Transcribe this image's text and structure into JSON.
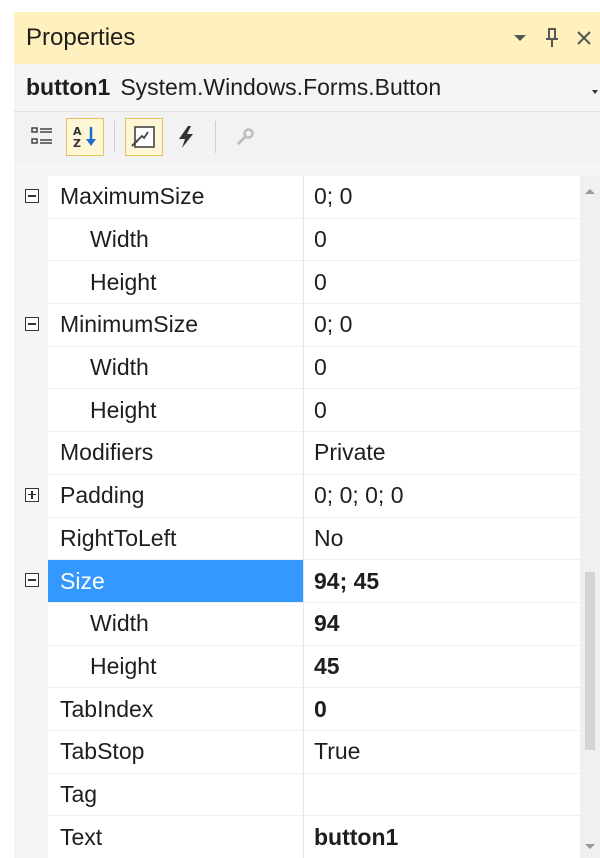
{
  "window": {
    "title": "Properties",
    "icons": [
      "dropdown-arrow-icon",
      "pin-icon",
      "close-icon"
    ]
  },
  "object_selector": {
    "name": "button1",
    "type": "System.Windows.Forms.Button"
  },
  "toolbar": {
    "tools": [
      {
        "icon": "categorized-icon",
        "active": false
      },
      {
        "icon": "alphabetical-icon",
        "active": true
      },
      {
        "icon": "properties-icon",
        "active": true
      },
      {
        "icon": "events-icon",
        "active": false
      },
      {
        "icon": "property-pages-icon",
        "active": false
      }
    ]
  },
  "properties": [
    {
      "name": "MaximumSize",
      "value": "0; 0",
      "expander": "minus",
      "child": false,
      "bold": false,
      "selected": false
    },
    {
      "name": "Width",
      "value": "0",
      "expander": "",
      "child": true,
      "bold": false,
      "selected": false
    },
    {
      "name": "Height",
      "value": "0",
      "expander": "",
      "child": true,
      "bold": false,
      "selected": false
    },
    {
      "name": "MinimumSize",
      "value": "0; 0",
      "expander": "minus",
      "child": false,
      "bold": false,
      "selected": false
    },
    {
      "name": "Width",
      "value": "0",
      "expander": "",
      "child": true,
      "bold": false,
      "selected": false
    },
    {
      "name": "Height",
      "value": "0",
      "expander": "",
      "child": true,
      "bold": false,
      "selected": false
    },
    {
      "name": "Modifiers",
      "value": "Private",
      "expander": "",
      "child": false,
      "bold": false,
      "selected": false
    },
    {
      "name": "Padding",
      "value": "0; 0; 0; 0",
      "expander": "plus",
      "child": false,
      "bold": false,
      "selected": false
    },
    {
      "name": "RightToLeft",
      "value": "No",
      "expander": "",
      "child": false,
      "bold": false,
      "selected": false
    },
    {
      "name": "Size",
      "value": "94; 45",
      "expander": "minus",
      "child": false,
      "bold": true,
      "selected": true
    },
    {
      "name": "Width",
      "value": "94",
      "expander": "",
      "child": true,
      "bold": true,
      "selected": false
    },
    {
      "name": "Height",
      "value": "45",
      "expander": "",
      "child": true,
      "bold": true,
      "selected": false
    },
    {
      "name": "TabIndex",
      "value": "0",
      "expander": "",
      "child": false,
      "bold": true,
      "selected": false
    },
    {
      "name": "TabStop",
      "value": "True",
      "expander": "",
      "child": false,
      "bold": false,
      "selected": false
    },
    {
      "name": "Tag",
      "value": "",
      "expander": "",
      "child": false,
      "bold": false,
      "selected": false
    },
    {
      "name": "Text",
      "value": "button1",
      "expander": "",
      "child": false,
      "bold": true,
      "selected": false
    }
  ],
  "colors": {
    "title_bg": "#fff1bd",
    "selection": "#3399ff"
  }
}
